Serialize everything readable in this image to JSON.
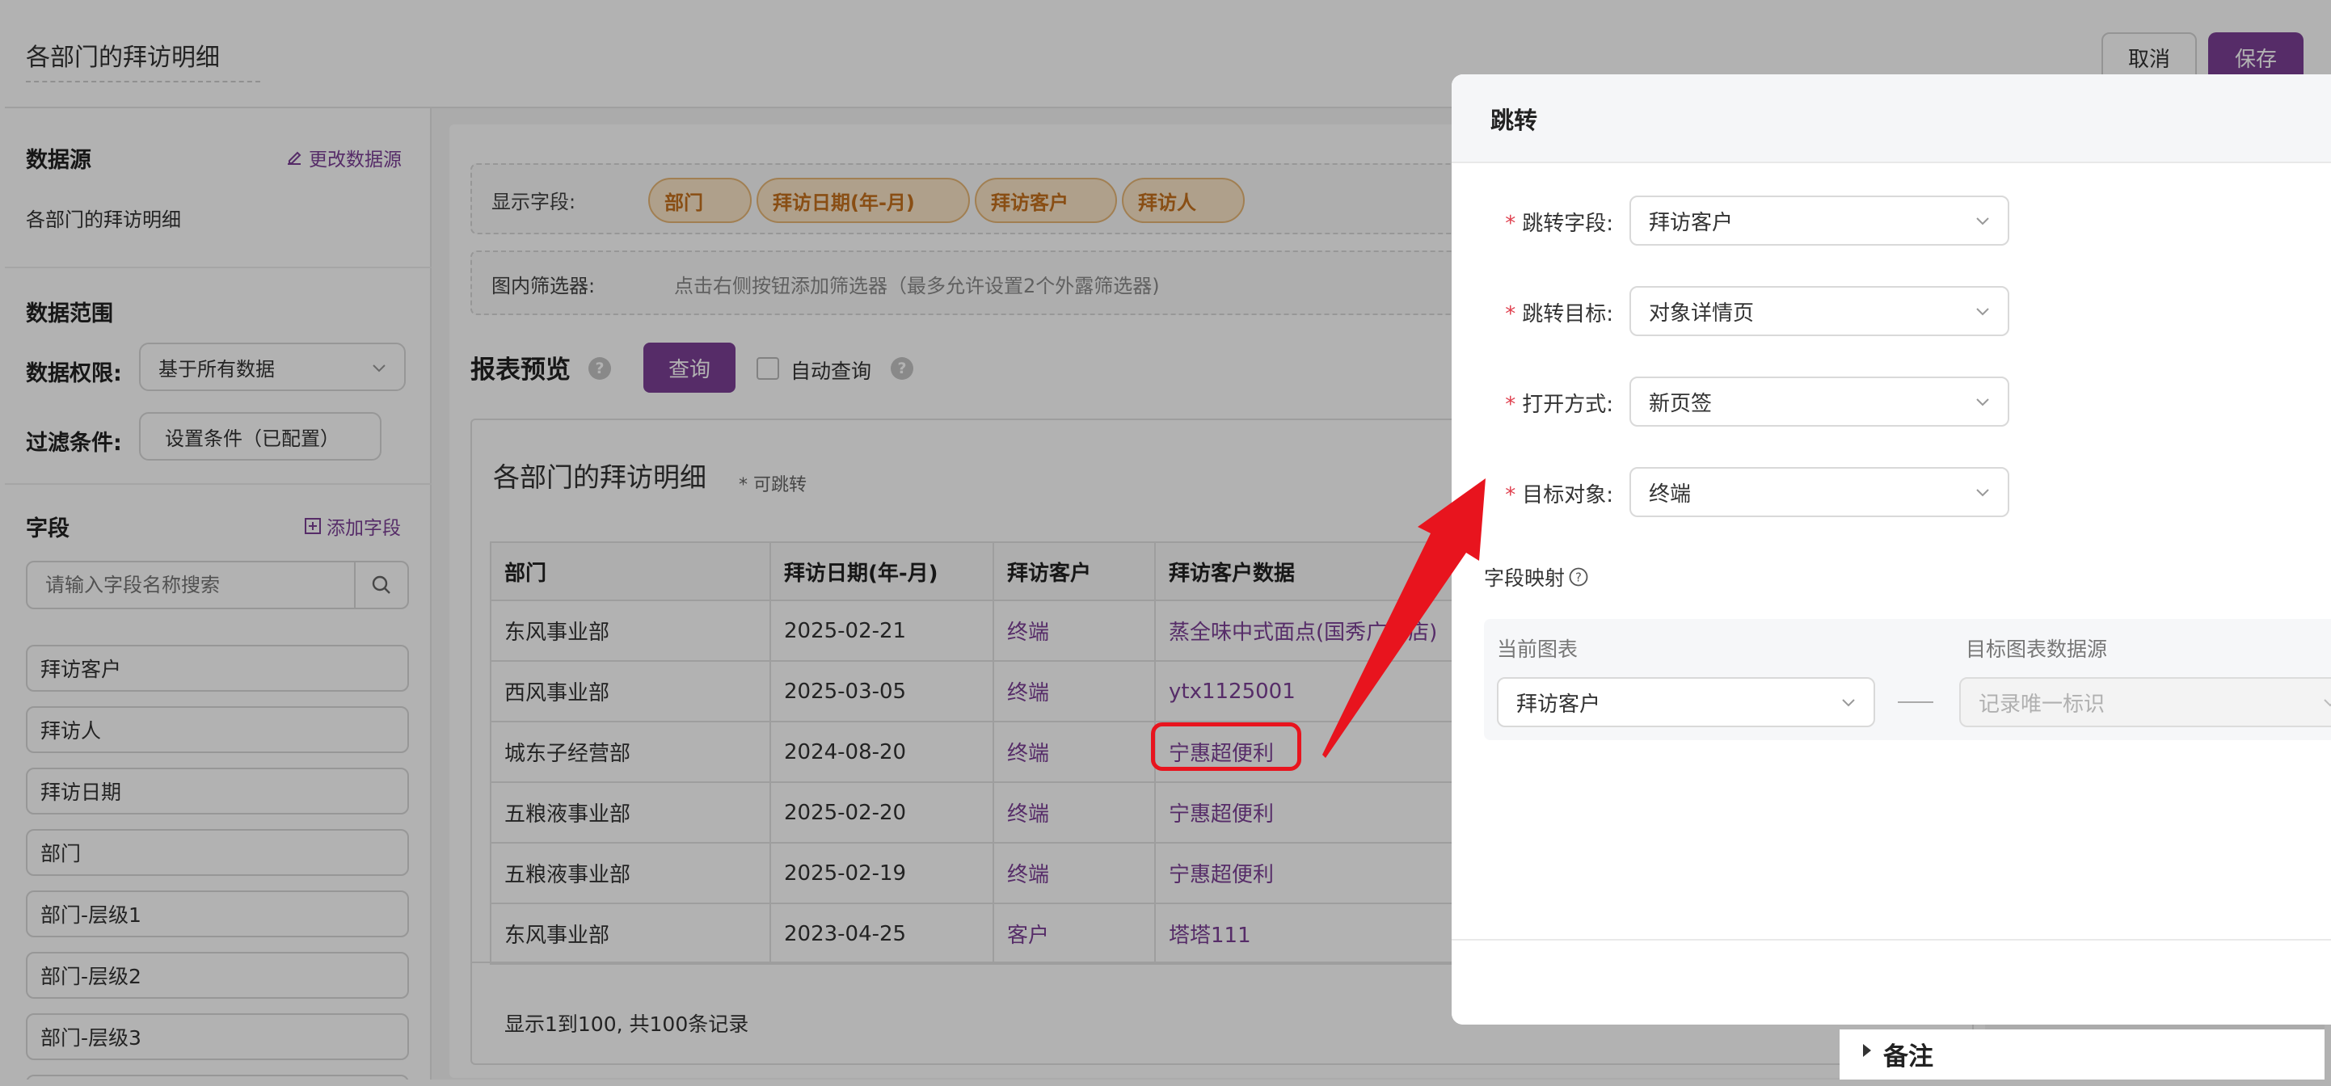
{
  "header": {
    "title": "各部门的拜访明细",
    "cancel_label": "取消",
    "save_label": "保存"
  },
  "sidebar": {
    "datasource_title": "数据源",
    "change_datasource_label": "更改数据源",
    "datasource_name": "各部门的拜访明细",
    "range_title": "数据范围",
    "permission_label": "数据权限:",
    "permission_value": "基于所有数据",
    "filter_label": "过滤条件:",
    "filter_value": "设置条件（已配置）",
    "fields_title": "字段",
    "add_field_label": "添加字段",
    "search_placeholder": "请输入字段名称搜索",
    "fields": [
      "拜访客户",
      "拜访人",
      "拜访日期",
      "部门",
      "部门-层级1",
      "部门-层级2",
      "部门-层级3"
    ]
  },
  "main": {
    "display_fields_label": "显示字段:",
    "display_fields": [
      "部门",
      "拜访日期(年-月)",
      "拜访客户",
      "拜访人"
    ],
    "filter_label": "图内筛选器:",
    "filter_hint": "点击右侧按钮添加筛选器（最多允许设置2个外露筛选器)",
    "preview_title": "报表预览",
    "query_label": "查询",
    "auto_query_label": "自动查询",
    "report_title": "各部门的拜访明细",
    "report_subtitle": "* 可跳转",
    "table": {
      "columns": [
        "部门",
        "拜访日期(年-月)",
        "拜访客户",
        "拜访客户数据"
      ],
      "rows": [
        [
          "东风事业部",
          "2025-02-21",
          "终端",
          "蒸全味中式面点(国秀广场店)"
        ],
        [
          "西风事业部",
          "2025-03-05",
          "终端",
          "ytx1125001"
        ],
        [
          "城东子经营部",
          "2024-08-20",
          "终端",
          "宁惠超便利"
        ],
        [
          "五粮液事业部",
          "2025-02-20",
          "终端",
          "宁惠超便利"
        ],
        [
          "五粮液事业部",
          "2025-02-19",
          "终端",
          "宁惠超便利"
        ],
        [
          "东风事业部",
          "2023-04-25",
          "客户",
          "塔塔111"
        ]
      ]
    },
    "pagination": "显示1到100, 共100条记录"
  },
  "dialog": {
    "title": "跳转",
    "jump_field_label": "跳转字段:",
    "jump_field_value": "拜访客户",
    "jump_target_label": "跳转目标:",
    "jump_target_value": "对象详情页",
    "open_mode_label": "打开方式:",
    "open_mode_value": "新页签",
    "target_object_label": "目标对象:",
    "target_object_value": "终端",
    "mapping_label": "字段映射",
    "current_chart_label": "当前图表",
    "target_source_label": "目标图表数据源",
    "current_chart_value": "拜访客户",
    "target_source_placeholder": "记录唯一标识"
  },
  "notes": {
    "label": "备注"
  },
  "colors": {
    "brand": "#7b3f96",
    "annotation": "#e8141e",
    "tag_bg": "#fbe6c8",
    "tag_text": "#c4701d",
    "required": "#e0414f"
  }
}
